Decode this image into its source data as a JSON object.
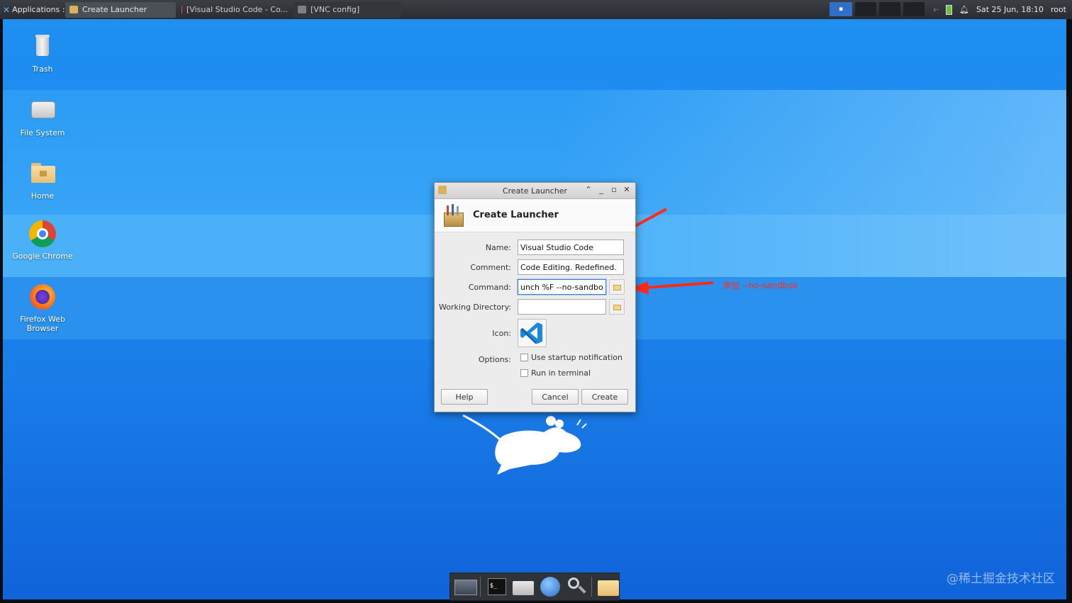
{
  "top_panel": {
    "applications_label": "Applications :",
    "tasks": [
      {
        "label": "Create Launcher"
      },
      {
        "label": "[Visual Studio Code - Co..."
      },
      {
        "label": "[VNC config]"
      }
    ],
    "clock": "Sat 25 Jun, 18:10",
    "user": "root"
  },
  "desktop": {
    "icons": [
      {
        "label": "Trash"
      },
      {
        "label": "File System"
      },
      {
        "label": "Home"
      },
      {
        "label": "Google Chrome"
      },
      {
        "label": "Firefox Web Browser"
      }
    ]
  },
  "dialog": {
    "window_title": "Create Launcher",
    "header_title": "Create Launcher",
    "fields": {
      "name_label": "Name:",
      "name_value": "Visual Studio Code",
      "comment_label": "Comment:",
      "comment_value": "Code Editing. Redefined.",
      "command_label": "Command:",
      "command_value": "unch %F --no-sandbox",
      "workdir_label": "Working Directory:",
      "workdir_value": "",
      "icon_label": "Icon:",
      "options_label": "Options:"
    },
    "options": [
      {
        "label": "Use startup notification",
        "checked": false
      },
      {
        "label": "Run in terminal",
        "checked": false
      }
    ],
    "buttons": {
      "help": "Help",
      "cancel": "Cancel",
      "create": "Create"
    }
  },
  "annotation": {
    "text": "添加 --no-sandbox",
    "color": "#ff2a1a"
  },
  "watermark": "@稀土掘金技术社区",
  "colors": {
    "desktop_blue": "#1a7ee9",
    "panel": "#2f3136",
    "accent": "#3d80df"
  },
  "icons": [
    "trash-icon",
    "drive-icon",
    "home-folder-icon",
    "chrome-icon",
    "firefox-icon",
    "vscode-icon",
    "folder-icon",
    "terminal-icon",
    "globe-icon",
    "search-icon",
    "mouse-mascot-icon",
    "bell-icon",
    "battery-icon"
  ]
}
